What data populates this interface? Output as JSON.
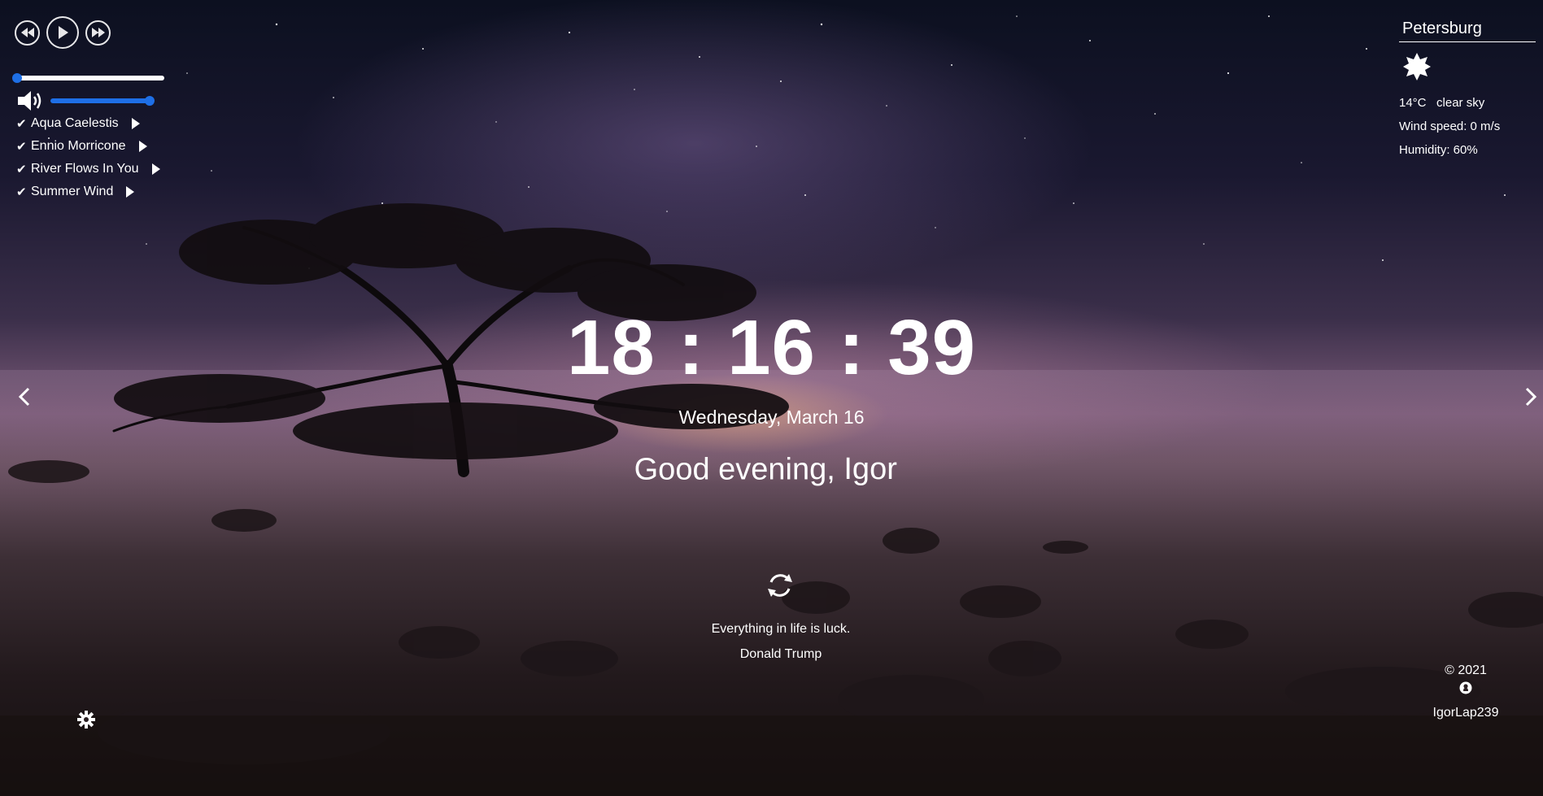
{
  "player": {
    "controls": {
      "prev_icon": "rewind-icon",
      "play_icon": "play-icon",
      "next_icon": "fast-forward-icon"
    },
    "progress": 0.0,
    "volume": 1.0,
    "volume_icon": "speaker-icon",
    "playlist": [
      {
        "title": "Aqua Caelestis"
      },
      {
        "title": "Ennio Morricone"
      },
      {
        "title": "River Flows In You"
      },
      {
        "title": "Summer Wind"
      }
    ]
  },
  "weather": {
    "city": "Petersburg",
    "icon": "sun-icon",
    "temperature": "14°C",
    "description": "clear sky",
    "wind": "Wind speed: 0 m/s",
    "humidity": "Humidity: 60%"
  },
  "clock": {
    "hours": "18",
    "minutes": "16",
    "seconds": "39",
    "separator": ":",
    "date": "Wednesday, March 16"
  },
  "greeting": {
    "text": "Good evening,",
    "name": "Igor"
  },
  "slider": {
    "prev_icon": "chevron-left-icon",
    "next_icon": "chevron-right-icon"
  },
  "quote": {
    "reload_icon": "refresh-icon",
    "text": "Everything in life is luck.",
    "author": "Donald Trump"
  },
  "settings": {
    "icon": "gear-icon"
  },
  "footer": {
    "copyright": "© 2021",
    "github_icon": "github-icon",
    "author": "IgorLap239"
  },
  "colors": {
    "accent": "#1e6fe6",
    "text": "#ffffff"
  }
}
